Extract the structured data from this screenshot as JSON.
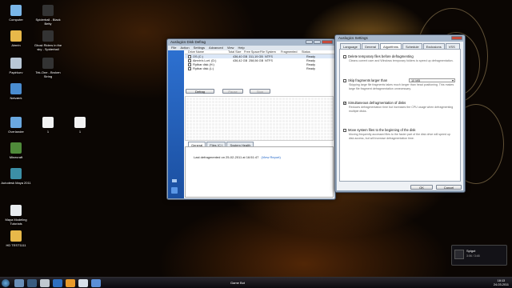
{
  "desktop": {
    "icons": [
      {
        "label": "Computer",
        "color": "#7ab6e8"
      },
      {
        "label": "Aimrin",
        "color": "#e8b84a"
      },
      {
        "label": "Papirkurv",
        "color": "#b9c7d6"
      },
      {
        "label": "Netværk",
        "color": "#4a8ccf"
      },
      {
        "label": "Overlander",
        "color": "#6aa8e0"
      },
      {
        "label": "Minecraft",
        "color": "#4f8a3a"
      },
      {
        "label": "Autodesk Maya 2011",
        "color": "#3c8fa6"
      },
      {
        "label": "Maya Modeling Tutorials",
        "color": "#e9ecef"
      },
      {
        "label": "HD TEST1111",
        "color": "#e8b84a"
      },
      {
        "label": "Spiderball - Black Betty",
        "color": "#333333"
      },
      {
        "label": "Ghost Riders in the sky - Spiderball",
        "color": "#333333"
      },
      {
        "label": "Tek-One - Broken String",
        "color": "#333333"
      },
      {
        "label": "1",
        "color": "#f2f2f2"
      },
      {
        "label": "1",
        "color": "#f2f2f2"
      }
    ]
  },
  "defrag_window": {
    "title": "Auslogics Disk Defrag",
    "menu": [
      "File",
      "Action",
      "Settings",
      "Advanced",
      "View",
      "Help"
    ],
    "columns": [
      "Drive Name",
      "Total Size",
      "Free Space",
      "File System",
      "Fragmented",
      "Status"
    ],
    "drives": [
      {
        "name": "OS (C:)",
        "total": "436,40 GB",
        "free": "311,19 GB",
        "fs": "NTFS",
        "frag": "",
        "status": "Ready"
      },
      {
        "name": "Aimrin's Lort. (D:)",
        "total": "436,42 GB",
        "free": "258,56 GB",
        "fs": "NTFS",
        "frag": "",
        "status": "Ready"
      },
      {
        "name": "Flytbar disk (H:)",
        "total": "",
        "free": "",
        "fs": "",
        "frag": "",
        "status": "Ready"
      },
      {
        "name": "Flytbar disk (L:)",
        "total": "",
        "free": "",
        "fs": "",
        "frag": "",
        "status": "Ready"
      }
    ],
    "buttons": {
      "defrag": "Defrag",
      "pause": "Pause",
      "stop": "Stop"
    },
    "tabs": [
      "General",
      "Files (C:)",
      "System Health"
    ],
    "last_defrag_text": "Last defragmented on 25-02-2011 at 16:51:47",
    "view_report": "(View Report)"
  },
  "settings_dialog": {
    "title": "Auslogics Settings",
    "tabs": [
      "Language",
      "General",
      "Algorithms",
      "Schedule",
      "Exclusions",
      "VSS Mode"
    ],
    "active_tab": "Algorithms",
    "options": [
      {
        "label": "Delete temporary files before defragmenting",
        "checked": false,
        "desc": "Cleans current user and Windows temporary folders to speed up defragmentation."
      },
      {
        "label": "Skip fragments larger than",
        "checked": false,
        "value": "10 MB",
        "desc": "Skipping large file fragments takes much longer than head positioning. This makes large file fragment defragmentation unnecessary."
      },
      {
        "label": "Simultaneous defragmentation of disks",
        "checked": true,
        "desc": "Reduces defragmentation time but increases the CPU usage when defragmenting multiple disks."
      },
      {
        "label": "Move system files to the beginning of the disk",
        "checked": false,
        "desc": "Moving frequently accessed files to the faster part of the disk drive will speed up disk access, but will increase defragmentation time."
      }
    ],
    "ok": "OK",
    "cancel": "Cancel"
  },
  "taskbar": {
    "active_label": "Game Bot",
    "clock_time": "18:13",
    "clock_date": "24-03-2011",
    "media_title": "Spigot",
    "media_sub": "3:06 / 3:48"
  },
  "colors": {
    "accent": "#1e64c8",
    "taskbar": "#15151c"
  }
}
